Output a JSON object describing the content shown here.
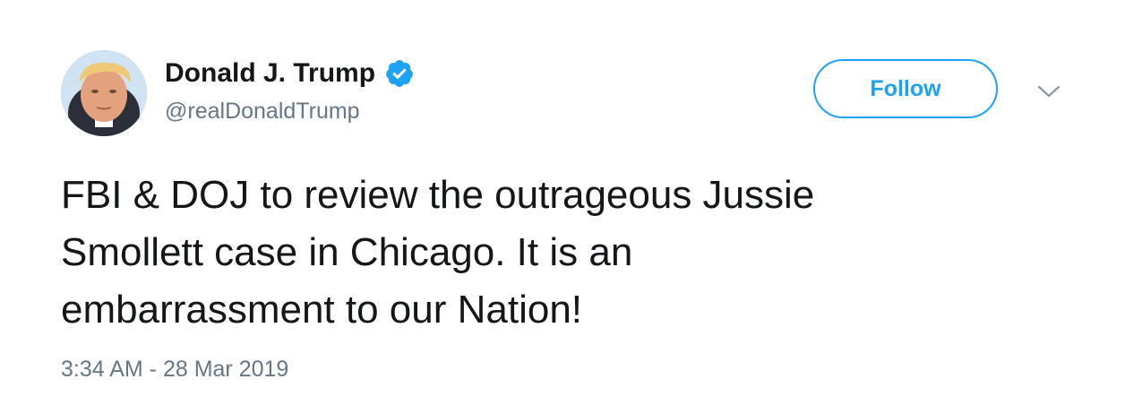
{
  "author": {
    "display_name": "Donald J. Trump",
    "handle": "@realDonaldTrump",
    "verified": true,
    "avatar_icon": "profile-photo"
  },
  "actions": {
    "follow_label": "Follow",
    "menu_icon": "chevron-down-icon"
  },
  "tweet": {
    "text_lines": [
      "FBI & DOJ to review the outrageous Jussie",
      "Smollett case in Chicago. It is an",
      "embarrassment to our Nation!"
    ],
    "timestamp": "3:34 AM - 28 Mar 2019"
  },
  "colors": {
    "accent": "#1da1f2",
    "text_primary": "#14171a",
    "text_secondary": "#657786"
  }
}
